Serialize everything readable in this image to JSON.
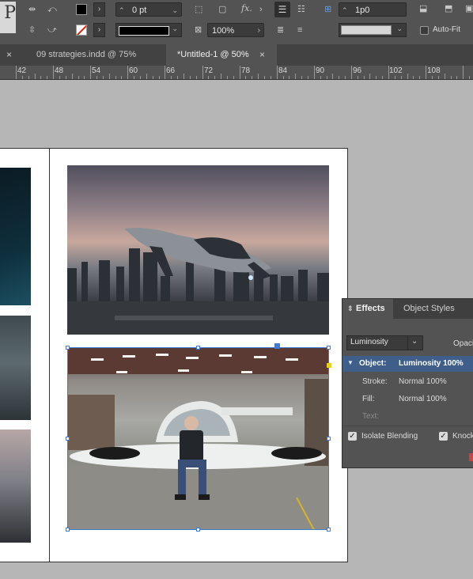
{
  "control_panel": {
    "stroke_weight": "0 pt",
    "scale_percent": "100%",
    "offset_value": "1p0",
    "auto_fit_label": "Auto-Fit",
    "fx_label": "fx."
  },
  "tabs": [
    {
      "label": "09 strategies.indd @ 75%",
      "active": false
    },
    {
      "label": "*Untitled-1 @ 50%",
      "active": true
    }
  ],
  "ruler": {
    "ticks": [
      "42",
      "48",
      "54",
      "60",
      "66",
      "72",
      "78",
      "84",
      "90",
      "96",
      "102",
      "108"
    ]
  },
  "effects_panel": {
    "tabs": [
      {
        "label": "Effects",
        "active": true
      },
      {
        "label": "Object Styles",
        "active": false
      }
    ],
    "blend_mode": "Luminosity",
    "opacity_label": "Opaci",
    "rows": [
      {
        "label": "Object:",
        "value": "Luminosity 100%"
      },
      {
        "label": "Stroke:",
        "value": "Normal 100%"
      },
      {
        "label": "Fill:",
        "value": "Normal 100%"
      },
      {
        "label": "Text:",
        "value": ""
      }
    ],
    "isolate_blending_label": "Isolate Blending",
    "knockout_label": "Knock"
  },
  "colors": {
    "accent": "#3d7bd6",
    "panel_bg": "#535353",
    "pasteboard": "#b6b6b6"
  }
}
